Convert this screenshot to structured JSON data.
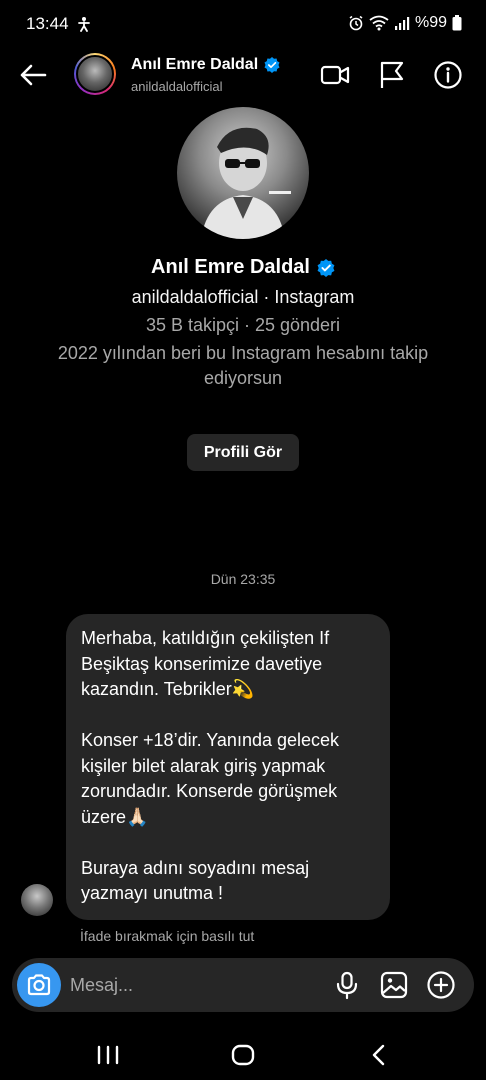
{
  "status_bar": {
    "time": "13:44",
    "battery": "%99"
  },
  "header": {
    "name": "Anıl Emre Daldal",
    "username": "anildaldalofficial"
  },
  "profile": {
    "name": "Anıl Emre Daldal",
    "handle_line": "anildaldalofficial · Instagram",
    "stats_line": "35 B takipçi · 25 gönderi",
    "follow_line_1": "2022 yılından beri bu Instagram hesabını takip",
    "follow_line_2": "ediyorsun",
    "view_profile_label": "Profili Gör"
  },
  "thread": {
    "timestamp": "Dün 23:35",
    "message": {
      "p1_l1": "Merhaba, katıldığın çekilişten If",
      "p1_l2": "Beşiktaş konserimize davetiye",
      "p1_l3": "kazandın. Tebrikler💫",
      "p2_l1": "Konser +18’dir. Yanında gelecek",
      "p2_l2": "kişiler bilet alarak giriş yapmak",
      "p2_l3": "zorundadır. Konserde görüşmek",
      "p2_l4": "üzere🙏🏻",
      "p3_l1": "Buraya adını soyadını mesaj",
      "p3_l2": "yazmayı unutma !"
    },
    "reaction_hint": "İfade bırakmak için basılı tut"
  },
  "composer": {
    "placeholder": "Mesaj..."
  },
  "colors": {
    "background": "#000000",
    "bubble": "#262626",
    "accent_blue": "#3797f0",
    "secondary_text": "#a8a8a8",
    "verified": "#0095f6"
  },
  "icons": {
    "back": "arrow-left-icon",
    "video": "video-camera-icon",
    "report": "flag-icon",
    "info": "info-icon",
    "verified": "verified-badge-icon",
    "camera": "camera-icon",
    "mic": "microphone-icon",
    "gallery": "image-icon",
    "add": "plus-circle-icon"
  }
}
